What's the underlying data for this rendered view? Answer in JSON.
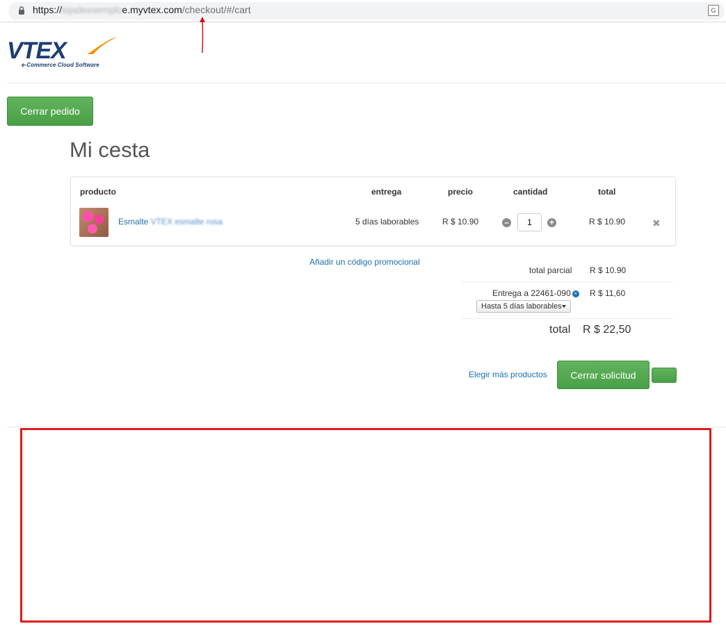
{
  "browser": {
    "url_prefix": "https://",
    "url_blurred": "lojadeexemplo",
    "url_domain": "e.myvtex.com",
    "url_path": "/checkout/#/cart",
    "annotation_color": "#d0121b"
  },
  "logo": {
    "text": "VTEX",
    "tagline": "e-Commerce Cloud Software",
    "color": "#1d3d73",
    "accent": "#f39200"
  },
  "header": {
    "close_order_button": "Cerrar pedido"
  },
  "page": {
    "title": "Mi cesta"
  },
  "cart": {
    "columns": [
      "producto",
      "entrega",
      "precio",
      "cantidad",
      "total"
    ],
    "item": {
      "name_visible": "Esmalte",
      "name_blurred": "VTEX esmalte rosa",
      "delivery": "5 días laborables",
      "price": "R $ 10.90",
      "quantity": "1",
      "total": "R $ 10.90"
    }
  },
  "summary": {
    "promo_link": "Añadir un código promocional",
    "subtotal_label": "total parcial",
    "subtotal_value": "R $ 10.90",
    "shipping_label": "Entrega a 22461-090",
    "shipping_value": "R $ 11,60",
    "shipping_option": "Hasta 5 días laborables",
    "total_label": "total",
    "total_value": "R $ 22,50"
  },
  "footer_actions": {
    "more_products": "Elegir más productos",
    "submit_button": "Cerrar solicitud"
  },
  "colors": {
    "primary_green": "#5cb85c",
    "link_blue": "#1a6fb0",
    "highlight_red": "#e01b1b"
  }
}
